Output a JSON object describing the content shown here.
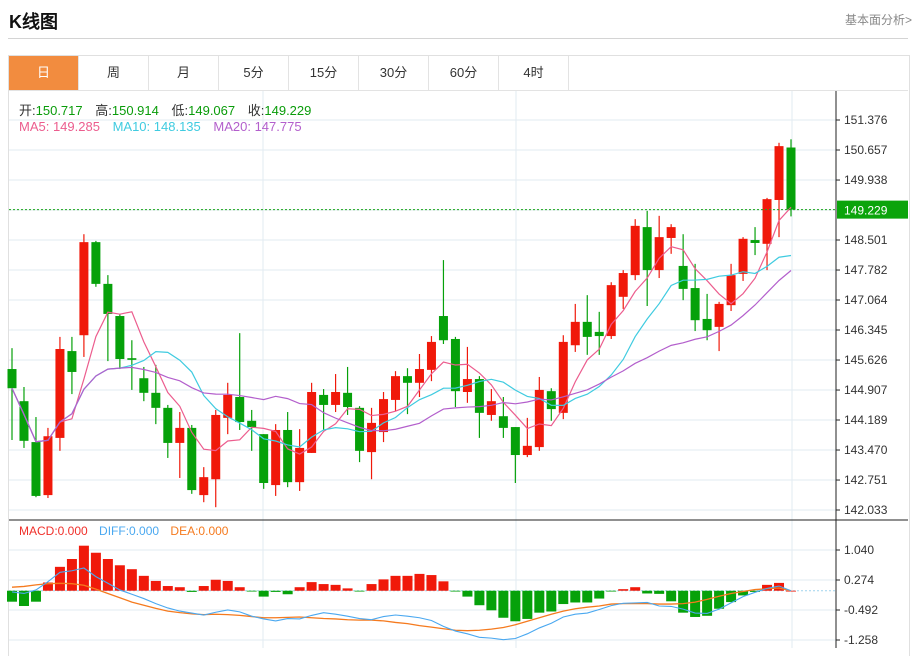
{
  "header": {
    "title": "K线图",
    "link": "基本面分析>"
  },
  "tabs": [
    {
      "label": "日",
      "active": true
    },
    {
      "label": "周"
    },
    {
      "label": "月"
    },
    {
      "label": "5分"
    },
    {
      "label": "15分"
    },
    {
      "label": "30分"
    },
    {
      "label": "60分"
    },
    {
      "label": "4时"
    }
  ],
  "ohlc_info": {
    "open_label": "开:",
    "open": "150.717",
    "high_label": "高:",
    "high": "150.914",
    "low_label": "低:",
    "low": "149.067",
    "close_label": "收:",
    "close": "149.229"
  },
  "ma_info": {
    "ma5": "MA5: 149.285",
    "ma10": "MA10: 148.135",
    "ma20": "MA20: 147.775"
  },
  "macd_info": {
    "macd": "MACD:0.000",
    "diff": "DIFF:0.000",
    "dea": "DEA:0.000"
  },
  "colors": {
    "up": "#f0190a",
    "down": "#06a10a",
    "ma5": "#ec5d8e",
    "ma10": "#3fcbe0",
    "ma20": "#b35fcc",
    "diff": "#4aa8f0",
    "dea": "#f57a1e",
    "active_tab": "#f28c3f"
  },
  "chart_data": [
    {
      "type": "candlestick",
      "title": "K线图",
      "ylim": [
        142.033,
        151.376
      ],
      "y_ticks": [
        "151.376",
        "150.657",
        "149.938",
        "148.501",
        "147.782",
        "147.064",
        "146.345",
        "145.626",
        "144.907",
        "144.189",
        "143.470",
        "142.751",
        "142.033"
      ],
      "y_tick_values": [
        151.376,
        150.657,
        149.938,
        148.501,
        147.782,
        147.064,
        146.345,
        145.626,
        144.907,
        144.189,
        143.47,
        142.751,
        142.033
      ],
      "current_price": 149.229,
      "current_price_label": "149.229",
      "ma_periods": [
        5,
        10,
        20
      ],
      "candles": [
        [
          145.41,
          145.91,
          143.71,
          144.95
        ],
        [
          144.64,
          144.98,
          143.52,
          143.69
        ],
        [
          143.66,
          144.26,
          142.34,
          142.37
        ],
        [
          142.39,
          144.0,
          142.32,
          143.8
        ],
        [
          143.76,
          146.18,
          143.45,
          145.89
        ],
        [
          145.84,
          146.18,
          144.81,
          145.34
        ],
        [
          146.22,
          148.64,
          145.7,
          148.45
        ],
        [
          148.45,
          148.48,
          147.38,
          147.45
        ],
        [
          147.45,
          147.66,
          145.6,
          146.73
        ],
        [
          146.68,
          146.73,
          145.41,
          145.65
        ],
        [
          145.67,
          146.1,
          144.91,
          145.63
        ],
        [
          145.19,
          145.46,
          144.64,
          144.84
        ],
        [
          144.84,
          145.51,
          144.09,
          144.48
        ],
        [
          144.48,
          144.55,
          143.28,
          143.64
        ],
        [
          143.64,
          144.38,
          142.8,
          144.0
        ],
        [
          144.0,
          144.07,
          142.42,
          142.51
        ],
        [
          142.39,
          143.06,
          142.22,
          142.82
        ],
        [
          142.77,
          144.43,
          142.1,
          144.31
        ],
        [
          144.24,
          145.08,
          143.85,
          144.79
        ],
        [
          144.74,
          146.27,
          143.95,
          144.14
        ],
        [
          144.17,
          144.43,
          143.45,
          144.02
        ],
        [
          143.85,
          143.85,
          142.54,
          142.68
        ],
        [
          142.63,
          144.09,
          142.37,
          143.95
        ],
        [
          143.95,
          144.38,
          142.58,
          142.7
        ],
        [
          142.7,
          143.97,
          142.49,
          143.52
        ],
        [
          143.4,
          145.08,
          143.4,
          144.86
        ],
        [
          144.79,
          144.93,
          143.95,
          144.55
        ],
        [
          144.55,
          145.29,
          144.38,
          144.86
        ],
        [
          144.84,
          145.46,
          144.31,
          144.5
        ],
        [
          144.48,
          144.52,
          143.18,
          143.45
        ],
        [
          143.42,
          144.48,
          142.77,
          144.12
        ],
        [
          143.9,
          144.86,
          143.66,
          144.69
        ],
        [
          144.67,
          145.36,
          144.4,
          145.24
        ],
        [
          145.24,
          145.43,
          144.33,
          145.08
        ],
        [
          145.08,
          145.77,
          144.74,
          145.41
        ],
        [
          145.39,
          146.2,
          145.12,
          146.06
        ],
        [
          146.68,
          148.02,
          146.01,
          146.1
        ],
        [
          146.13,
          146.18,
          144.5,
          144.88
        ],
        [
          144.86,
          145.94,
          144.6,
          145.17
        ],
        [
          145.17,
          145.24,
          143.76,
          144.36
        ],
        [
          144.31,
          144.93,
          144.17,
          144.64
        ],
        [
          144.28,
          144.74,
          143.76,
          144.0
        ],
        [
          144.02,
          144.02,
          142.68,
          143.35
        ],
        [
          143.35,
          144.24,
          143.3,
          143.57
        ],
        [
          143.54,
          145.22,
          143.45,
          144.91
        ],
        [
          144.88,
          144.95,
          144.17,
          144.45
        ],
        [
          144.36,
          146.22,
          144.21,
          146.06
        ],
        [
          145.98,
          146.97,
          145.82,
          146.54
        ],
        [
          146.54,
          147.18,
          145.75,
          146.18
        ],
        [
          146.3,
          146.78,
          145.75,
          146.2
        ],
        [
          146.2,
          147.49,
          146.13,
          147.42
        ],
        [
          147.14,
          147.78,
          146.85,
          147.71
        ],
        [
          147.66,
          149.0,
          147.54,
          148.84
        ],
        [
          148.81,
          149.2,
          146.92,
          147.78
        ],
        [
          147.78,
          149.08,
          147.59,
          148.57
        ],
        [
          148.55,
          148.88,
          148.17,
          148.81
        ],
        [
          147.88,
          148.64,
          147.06,
          147.33
        ],
        [
          147.35,
          147.93,
          146.32,
          146.58
        ],
        [
          146.61,
          147.21,
          146.1,
          146.34
        ],
        [
          146.42,
          147.02,
          145.84,
          146.97
        ],
        [
          146.94,
          147.93,
          146.8,
          147.66
        ],
        [
          147.69,
          148.57,
          147.52,
          148.53
        ],
        [
          148.5,
          148.81,
          148.14,
          148.43
        ],
        [
          148.41,
          149.51,
          147.78,
          149.48
        ],
        [
          149.46,
          150.83,
          148.57,
          150.75
        ],
        [
          150.717,
          150.914,
          149.067,
          149.229
        ]
      ]
    },
    {
      "type": "bar+line",
      "title": "MACD",
      "ylim": [
        -1.258,
        1.04
      ],
      "y_ticks": [
        "1.040",
        "0.274",
        "-0.492",
        "-1.258"
      ],
      "y_tick_values": [
        1.04,
        0.274,
        -0.492,
        -1.258
      ],
      "macd": [
        -0.28,
        -0.39,
        -0.28,
        0.21,
        0.61,
        0.81,
        1.15,
        0.97,
        0.81,
        0.65,
        0.55,
        0.38,
        0.25,
        0.12,
        0.09,
        -0.03,
        0.12,
        0.28,
        0.25,
        0.09,
        -0.02,
        -0.15,
        -0.03,
        -0.09,
        0.09,
        0.22,
        0.17,
        0.15,
        0.06,
        -0.01,
        0.17,
        0.29,
        0.38,
        0.38,
        0.43,
        0.4,
        0.24,
        -0.02,
        -0.15,
        -0.37,
        -0.5,
        -0.69,
        -0.78,
        -0.72,
        -0.56,
        -0.53,
        -0.34,
        -0.3,
        -0.3,
        -0.2,
        -0.02,
        0.04,
        0.09,
        -0.07,
        -0.08,
        -0.27,
        -0.56,
        -0.67,
        -0.64,
        -0.46,
        -0.29,
        -0.12,
        -0.03,
        0.15,
        0.2,
        0.0
      ],
      "diff": [
        -0.03,
        -0.07,
        0.02,
        0.23,
        0.47,
        0.51,
        0.58,
        0.36,
        0.19,
        0.02,
        -0.09,
        -0.2,
        -0.33,
        -0.44,
        -0.52,
        -0.57,
        -0.62,
        -0.55,
        -0.49,
        -0.54,
        -0.65,
        -0.72,
        -0.77,
        -0.71,
        -0.72,
        -0.63,
        -0.56,
        -0.6,
        -0.65,
        -0.71,
        -0.74,
        -0.66,
        -0.62,
        -0.65,
        -0.69,
        -0.76,
        -0.91,
        -1.03,
        -1.1,
        -1.19,
        -1.21,
        -1.25,
        -1.22,
        -1.1,
        -0.95,
        -0.83,
        -0.67,
        -0.6,
        -0.57,
        -0.48,
        -0.38,
        -0.32,
        -0.31,
        -0.3,
        -0.39,
        -0.4,
        -0.47,
        -0.57,
        -0.58,
        -0.47,
        -0.31,
        -0.15,
        -0.04,
        0.06,
        0.12,
        0.0
      ],
      "dea": [
        0.09,
        0.11,
        0.15,
        0.18,
        0.19,
        0.18,
        0.14,
        0.04,
        -0.07,
        -0.18,
        -0.29,
        -0.37,
        -0.45,
        -0.52,
        -0.56,
        -0.59,
        -0.61,
        -0.6,
        -0.61,
        -0.63,
        -0.66,
        -0.69,
        -0.69,
        -0.68,
        -0.67,
        -0.69,
        -0.71,
        -0.72,
        -0.74,
        -0.75,
        -0.75,
        -0.77,
        -0.81,
        -0.84,
        -0.89,
        -0.93,
        -0.97,
        -1.01,
        -1.02,
        -1.01,
        -0.98,
        -0.94,
        -0.87,
        -0.78,
        -0.69,
        -0.6,
        -0.52,
        -0.46,
        -0.42,
        -0.39,
        -0.34,
        -0.33,
        -0.33,
        -0.33,
        -0.34,
        -0.34,
        -0.33,
        -0.29,
        -0.22,
        -0.14,
        -0.07,
        -0.02,
        0.03,
        0.05,
        0.07,
        0.0
      ]
    }
  ]
}
